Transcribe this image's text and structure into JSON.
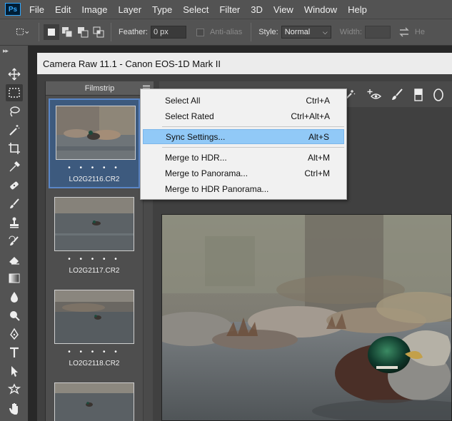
{
  "app": {
    "logo": "Ps"
  },
  "menu": [
    "File",
    "Edit",
    "Image",
    "Layer",
    "Type",
    "Select",
    "Filter",
    "3D",
    "View",
    "Window",
    "Help"
  ],
  "options_bar": {
    "feather_label": "Feather:",
    "feather_value": "0 px",
    "antialias_label": "Anti-alias",
    "style_label": "Style:",
    "style_value": "Normal",
    "width_label": "Width:",
    "height_label_partial": "He"
  },
  "window": {
    "title": "Camera Raw 11.1  -  Canon EOS-1D Mark II"
  },
  "filmstrip": {
    "header": "Filmstrip",
    "thumbnails": [
      {
        "filename": "LO2G2116.CR2",
        "dots": "• • • • •",
        "selected": true
      },
      {
        "filename": "LO2G2117.CR2",
        "dots": "• • • • •",
        "selected": false
      },
      {
        "filename": "LO2G2118.CR2",
        "dots": "• • • • •",
        "selected": false
      }
    ]
  },
  "context_menu": {
    "items": [
      {
        "label": "Select All",
        "shortcut": "Ctrl+A"
      },
      {
        "label": "Select Rated",
        "shortcut": "Ctrl+Alt+A"
      },
      {
        "label": "Sync Settings...",
        "shortcut": "Alt+S",
        "highlighted": true
      },
      {
        "label": "Merge to HDR...",
        "shortcut": "Alt+M"
      },
      {
        "label": "Merge to Panorama...",
        "shortcut": "Ctrl+M"
      },
      {
        "label": "Merge to HDR Panorama...",
        "shortcut": ""
      }
    ]
  },
  "colors": {
    "chrome": "#535353",
    "selection_highlight": "#91c9f7",
    "thumbnail_selected": "#3d5a7e"
  }
}
